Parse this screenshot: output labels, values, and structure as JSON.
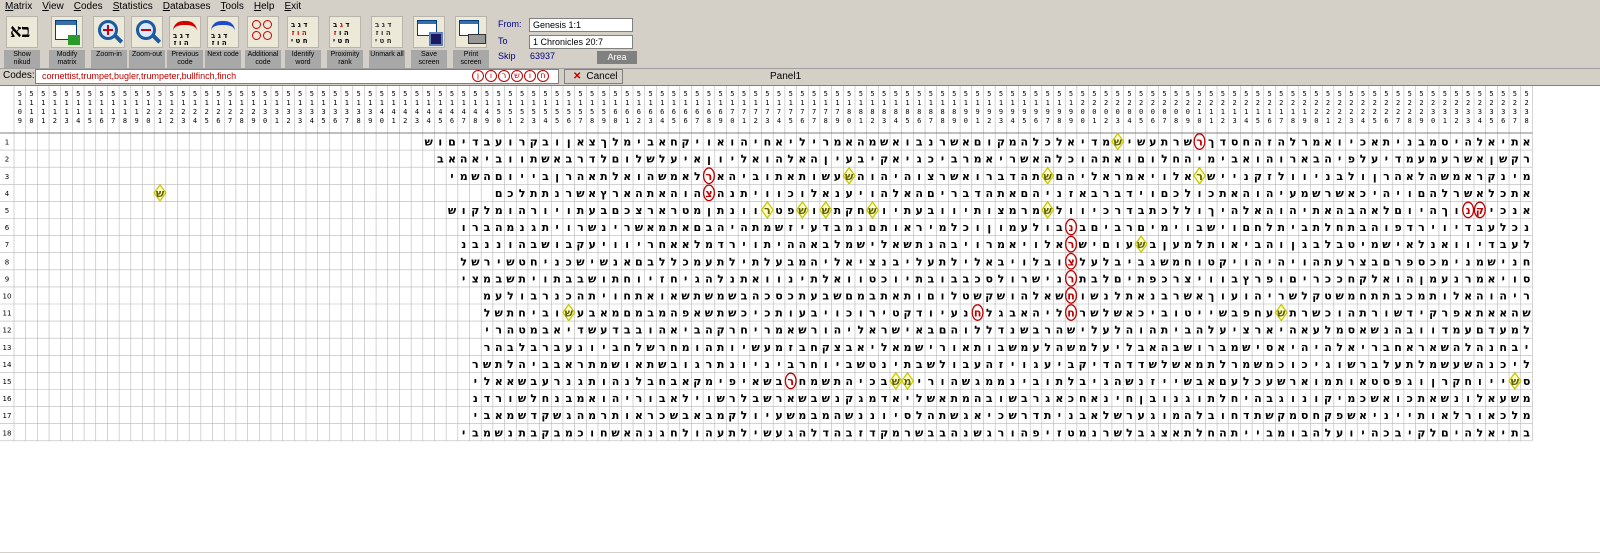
{
  "menu": [
    "Matrix",
    "View",
    "Codes",
    "Statistics",
    "Databases",
    "Tools",
    "Help",
    "Exit"
  ],
  "toolbar": [
    {
      "name": "show-nikud-button",
      "icon": "aleph-bet-icon",
      "label": "Show nikud"
    },
    {
      "name": "modify-matrix-button",
      "icon": "matrix-grid-icon",
      "label": "Modify matrix"
    },
    {
      "name": "zoom-in-button",
      "icon": "zoom-in-icon",
      "label": "Zoom-in"
    },
    {
      "name": "zoom-out-button",
      "icon": "zoom-out-icon",
      "label": "Zoom-out"
    },
    {
      "name": "previous-code-button",
      "icon": "previous-code-icon",
      "label": "Previous code"
    },
    {
      "name": "next-code-button",
      "icon": "next-code-icon",
      "label": "Next code"
    },
    {
      "name": "additional-code-button",
      "icon": "additional-code-icon",
      "label": "Additional code"
    },
    {
      "name": "identify-word-button",
      "icon": "identify-word-icon",
      "label": "Identify word"
    },
    {
      "name": "proximity-rank-button",
      "icon": "proximity-rank-icon",
      "label": "Proximity rank"
    },
    {
      "name": "unmark-all-button",
      "icon": "unmark-all-icon",
      "label": "Unmark all"
    },
    {
      "name": "save-screen-button",
      "icon": "save-icon",
      "label": "Save screen"
    },
    {
      "name": "print-screen-button",
      "icon": "printer-icon",
      "label": "Print screen"
    }
  ],
  "range": {
    "from_label": "From:",
    "from_value": "Genesis 1:1",
    "to_label": "To",
    "to_value": "1 Chronicles 20:7",
    "skip_label": "Skip",
    "skip_value": "63937",
    "area_label": "Area"
  },
  "codes": {
    "label": "Codes:",
    "value": "cornettist,trumpet,bugler,trumpeter,bullfinch,finch",
    "cancel_label": "Cancel",
    "panel_label": "Panel1",
    "pills": [
      "ן",
      "ו",
      "ר",
      "ש",
      "ו",
      "ח"
    ]
  },
  "matrix": {
    "headers": [
      "5109",
      "5110",
      "5111",
      "5112",
      "5113",
      "5114",
      "5115",
      "5116",
      "5117",
      "5118",
      "5119",
      "5120",
      "5121",
      "5122",
      "5123",
      "5124",
      "5125",
      "5126",
      "5127",
      "5128",
      "5129",
      "5130",
      "5131",
      "5132",
      "5133",
      "5134",
      "5135",
      "5136",
      "5137",
      "5138",
      "5139",
      "5140",
      "5141",
      "5142",
      "5143",
      "5144",
      "5145",
      "5146",
      "5147",
      "5148",
      "5149",
      "5150",
      "5151",
      "5152",
      "5153",
      "5154",
      "5155",
      "5156",
      "5157",
      "5158",
      "5159",
      "5160",
      "5161",
      "5162",
      "5163",
      "5164",
      "5165",
      "5166",
      "5167",
      "5168",
      "5169",
      "5170",
      "5171",
      "5172",
      "5173",
      "5174",
      "5175",
      "5176",
      "5177",
      "5178",
      "5179",
      "5180",
      "5181",
      "5182",
      "5183",
      "5184",
      "5185",
      "5186",
      "5187",
      "5188",
      "5189",
      "5190",
      "5191",
      "5192",
      "5193",
      "5194",
      "5195",
      "5196",
      "5197",
      "5198",
      "5199",
      "5200",
      "5201",
      "5202",
      "5203",
      "5204",
      "5205",
      "5206",
      "5207",
      "5208",
      "5209",
      "5210",
      "5211",
      "5212",
      "5213",
      "5214",
      "5215",
      "5216",
      "5217",
      "5218",
      "5219",
      "5220",
      "5221",
      "5222",
      "5223",
      "5224",
      "5225",
      "5226",
      "5227",
      "5228",
      "5229",
      "5230",
      "5231",
      "5232",
      "5233",
      "5234",
      "5235",
      "5236",
      "5237",
      "5238"
    ],
    "row_labels": [
      "1",
      "2",
      "3",
      "4",
      "5",
      "6",
      "7",
      "8",
      "9",
      "10",
      "11",
      "12",
      "13",
      "14",
      "15",
      "16",
      "17",
      "18"
    ],
    "rows": [
      "אתיאלהיסמבניתאכיואמרלהזהחסדךאשרתעשיעמדיאלכלהמקוםאשרנבואשמהאמריליאחיהואויקחאבימלךצאןובקרועבדיםוש",
      "רקשןאשרעמעמדיעלפיהבארוהואבימיהחלוםואתהוכלהאשריאמרביכגיאקיבעיןהאלהואליוןאיעלשלוםלדרבאשתווביאהאב",
      "מינקראמשהלאהרןולבניוולזקניישראלויאמראליהםאתהדברואשרצוהיהוהלעשותאתוביהאבלאמשהואלתאהרןבייוםהשמי",
      "אתכלאשרלהםויהיכאשרשמעיהוהאתכולכםוידברבאזניהםאתהדבריםהאלהויענאלוכוויתנהיהוהאתהארץאשרנתתלכם",
      "אנכימצוךהיוםלאהבהאתיהוהאלהיךוללכתבדרכיוולשמרמצותיוובעתיווחקתיושפטיוונתןמטרארצכםבעתויורהומלקוש",
      "נכלעבדיוירדפוהבתחלתביתלחםוישבוימיםרביםבגבולעמוןוכלמיראותםנמבדעיזשמתהיהבםאתמאשרינשרויתגנמהברו",
      "לעבדיוואנלאישמיטבלבגןוהביאותלמעןבצעוםישראלויאמרויבהנתשאלישמלבאההיתוירדמלאאחריוויעקבושבהוננבנ",
      "חנישמנימכספרםבצרעתהויהיהויקטוחמשגביבלעלכובלויבאלילתעליבנציאליהמבעלתילתעמכללבםאנשישכניחטשירשל",
      "סויאמרנעמןהואלקחככריםופרץבוויצרכפתיםלבתשנישרולסכבבובתיוכטוואלתינוואתנלהגיחזיוחתושבבתויתשבמצי",
      "ריהוהאלותמכבתתחמשטקלשריהועוךאשרבנאתלנשוךשאלהושקשטלוםותאתבמםשבעתכסכהבשמשתשאואתחויתהכנרבולעמ",
      "שהאאתאפרקידשורתהוכשרתיעחפבשייטוביכאשלשרבליהאבגלשנעיודקטירוכויבעותכיכשתשאפהמבמםמאבעבוביחתשל",
      "למעדםעמדוובהנשאסמלעאהיארציעלהביתהוהלעלישהרבשנדללוהםבאישראליהורשאמריחרקהביאהובבדעשדיאבמטהרי",
      "יבחנהלהשאראחבריאלהיהיאסישמברושבהאבליעלמשהלעמשבותאורישמאליאבצקחבזמעשיותהומחרשלחביונעברבלבהר",
      "ליכנהשעשמלתעלברשוגיכוכמשמרלתמאשלשדדהדיקביעגויזהעבולשבתינטשביוחרביניונתרגובשתאושמתראבביהלתשר",
      "סנייוחקרןוגפסטאותמוארשעכלעםאבשייזנשהגיבלתובינממגשהוריתיבכיהתשמחלבשאיפימקאבחבלנהותגנרעבשאאלי",
      "משעאלונשאתכואשכמיקונוגבהיחלתוגנובןחינאחכאגרבשובהמתאשליאדמגקנשבשארשבלרשוילאבוריהואמבנחלשורדנ",
      "מלכאורלאותייניאשפקחסמקשתדחובלהמוגערשלאבניתדרשכיאגשתהלסיוננשהמבמשעיולקמבאבשכראותרמהגשקדשמאבי",
      "בתיאלהיםלקיבכהיועלהבומבייתהחלתאצגבלשרנמטזיפהורגשנהבבשרמקדזבהדלהגעשילתעהולחגנהאשחוכמבקבתנשמבי"
    ],
    "marks": [
      {
        "row": 1,
        "col": 28,
        "letter": "ר",
        "color": "#c00000",
        "shape": "ellipse"
      },
      {
        "row": 1,
        "col": 35,
        "letter": "ש",
        "color": "#c8c800",
        "shape": "diamond"
      },
      {
        "row": 3,
        "col": 28,
        "letter": "ר",
        "color": "#c8c800",
        "shape": "diamond"
      },
      {
        "row": 3,
        "col": 41,
        "letter": "ש",
        "color": "#c8c800",
        "shape": "diamond"
      },
      {
        "row": 3,
        "col": 58,
        "letter": "ש",
        "color": "#c8c800",
        "shape": "diamond"
      },
      {
        "row": 3,
        "col": 70,
        "letter": "ר",
        "color": "#c00000",
        "shape": "ellipse"
      },
      {
        "row": 4,
        "col": 70,
        "letter": "צ",
        "color": "#c00000",
        "shape": "ellipse"
      },
      {
        "row": 4,
        "col": 117,
        "letter": "ש",
        "color": "#c8c800",
        "shape": "diamond"
      },
      {
        "row": 5,
        "col": 4,
        "letter": "ק",
        "color": "#c00000",
        "shape": "ellipse"
      },
      {
        "row": 5,
        "col": 5,
        "letter": "נ",
        "color": "#c00000",
        "shape": "ellipse"
      },
      {
        "row": 5,
        "col": 41,
        "letter": "ש",
        "color": "#c8c800",
        "shape": "diamond"
      },
      {
        "row": 5,
        "col": 56,
        "letter": "ש",
        "color": "#c8c800",
        "shape": "diamond"
      },
      {
        "row": 5,
        "col": 60,
        "letter": "ש",
        "color": "#c8c800",
        "shape": "diamond"
      },
      {
        "row": 5,
        "col": 62,
        "letter": "ש",
        "color": "#c8c800",
        "shape": "diamond"
      },
      {
        "row": 5,
        "col": 65,
        "letter": "ר",
        "color": "#c8c800",
        "shape": "diamond"
      },
      {
        "row": 6,
        "col": 39,
        "letter": "נ",
        "color": "#c00000",
        "shape": "ellipse"
      },
      {
        "row": 7,
        "col": 33,
        "letter": "ש",
        "color": "#c8c800",
        "shape": "diamond"
      },
      {
        "row": 7,
        "col": 39,
        "letter": "ר",
        "color": "#c00000",
        "shape": "ellipse"
      },
      {
        "row": 8,
        "col": 39,
        "letter": "צ",
        "color": "#c00000",
        "shape": "ellipse"
      },
      {
        "row": 9,
        "col": 39,
        "letter": "ר",
        "color": "#c00000",
        "shape": "ellipse"
      },
      {
        "row": 10,
        "col": 39,
        "letter": "ח",
        "color": "#c00000",
        "shape": "ellipse"
      },
      {
        "row": 11,
        "col": 39,
        "letter": "ח",
        "color": "#c00000",
        "shape": "ellipse"
      },
      {
        "row": 11,
        "col": 47,
        "letter": "ח",
        "color": "#c00000",
        "shape": "ellipse"
      },
      {
        "row": 11,
        "col": 21,
        "letter": "ש",
        "color": "#c8c800",
        "shape": "diamond"
      },
      {
        "row": 11,
        "col": 82,
        "letter": "ש",
        "color": "#c8c800",
        "shape": "diamond"
      },
      {
        "row": 15,
        "col": 1,
        "letter": "ש",
        "color": "#c8c800",
        "shape": "diamond"
      },
      {
        "row": 15,
        "col": 53,
        "letter": "מ",
        "color": "#c8c800",
        "shape": "diamond"
      },
      {
        "row": 15,
        "col": 54,
        "letter": "ש",
        "color": "#c8c800",
        "shape": "diamond"
      },
      {
        "row": 15,
        "col": 63,
        "letter": "ר",
        "color": "#c00000",
        "shape": "ellipse"
      }
    ]
  }
}
